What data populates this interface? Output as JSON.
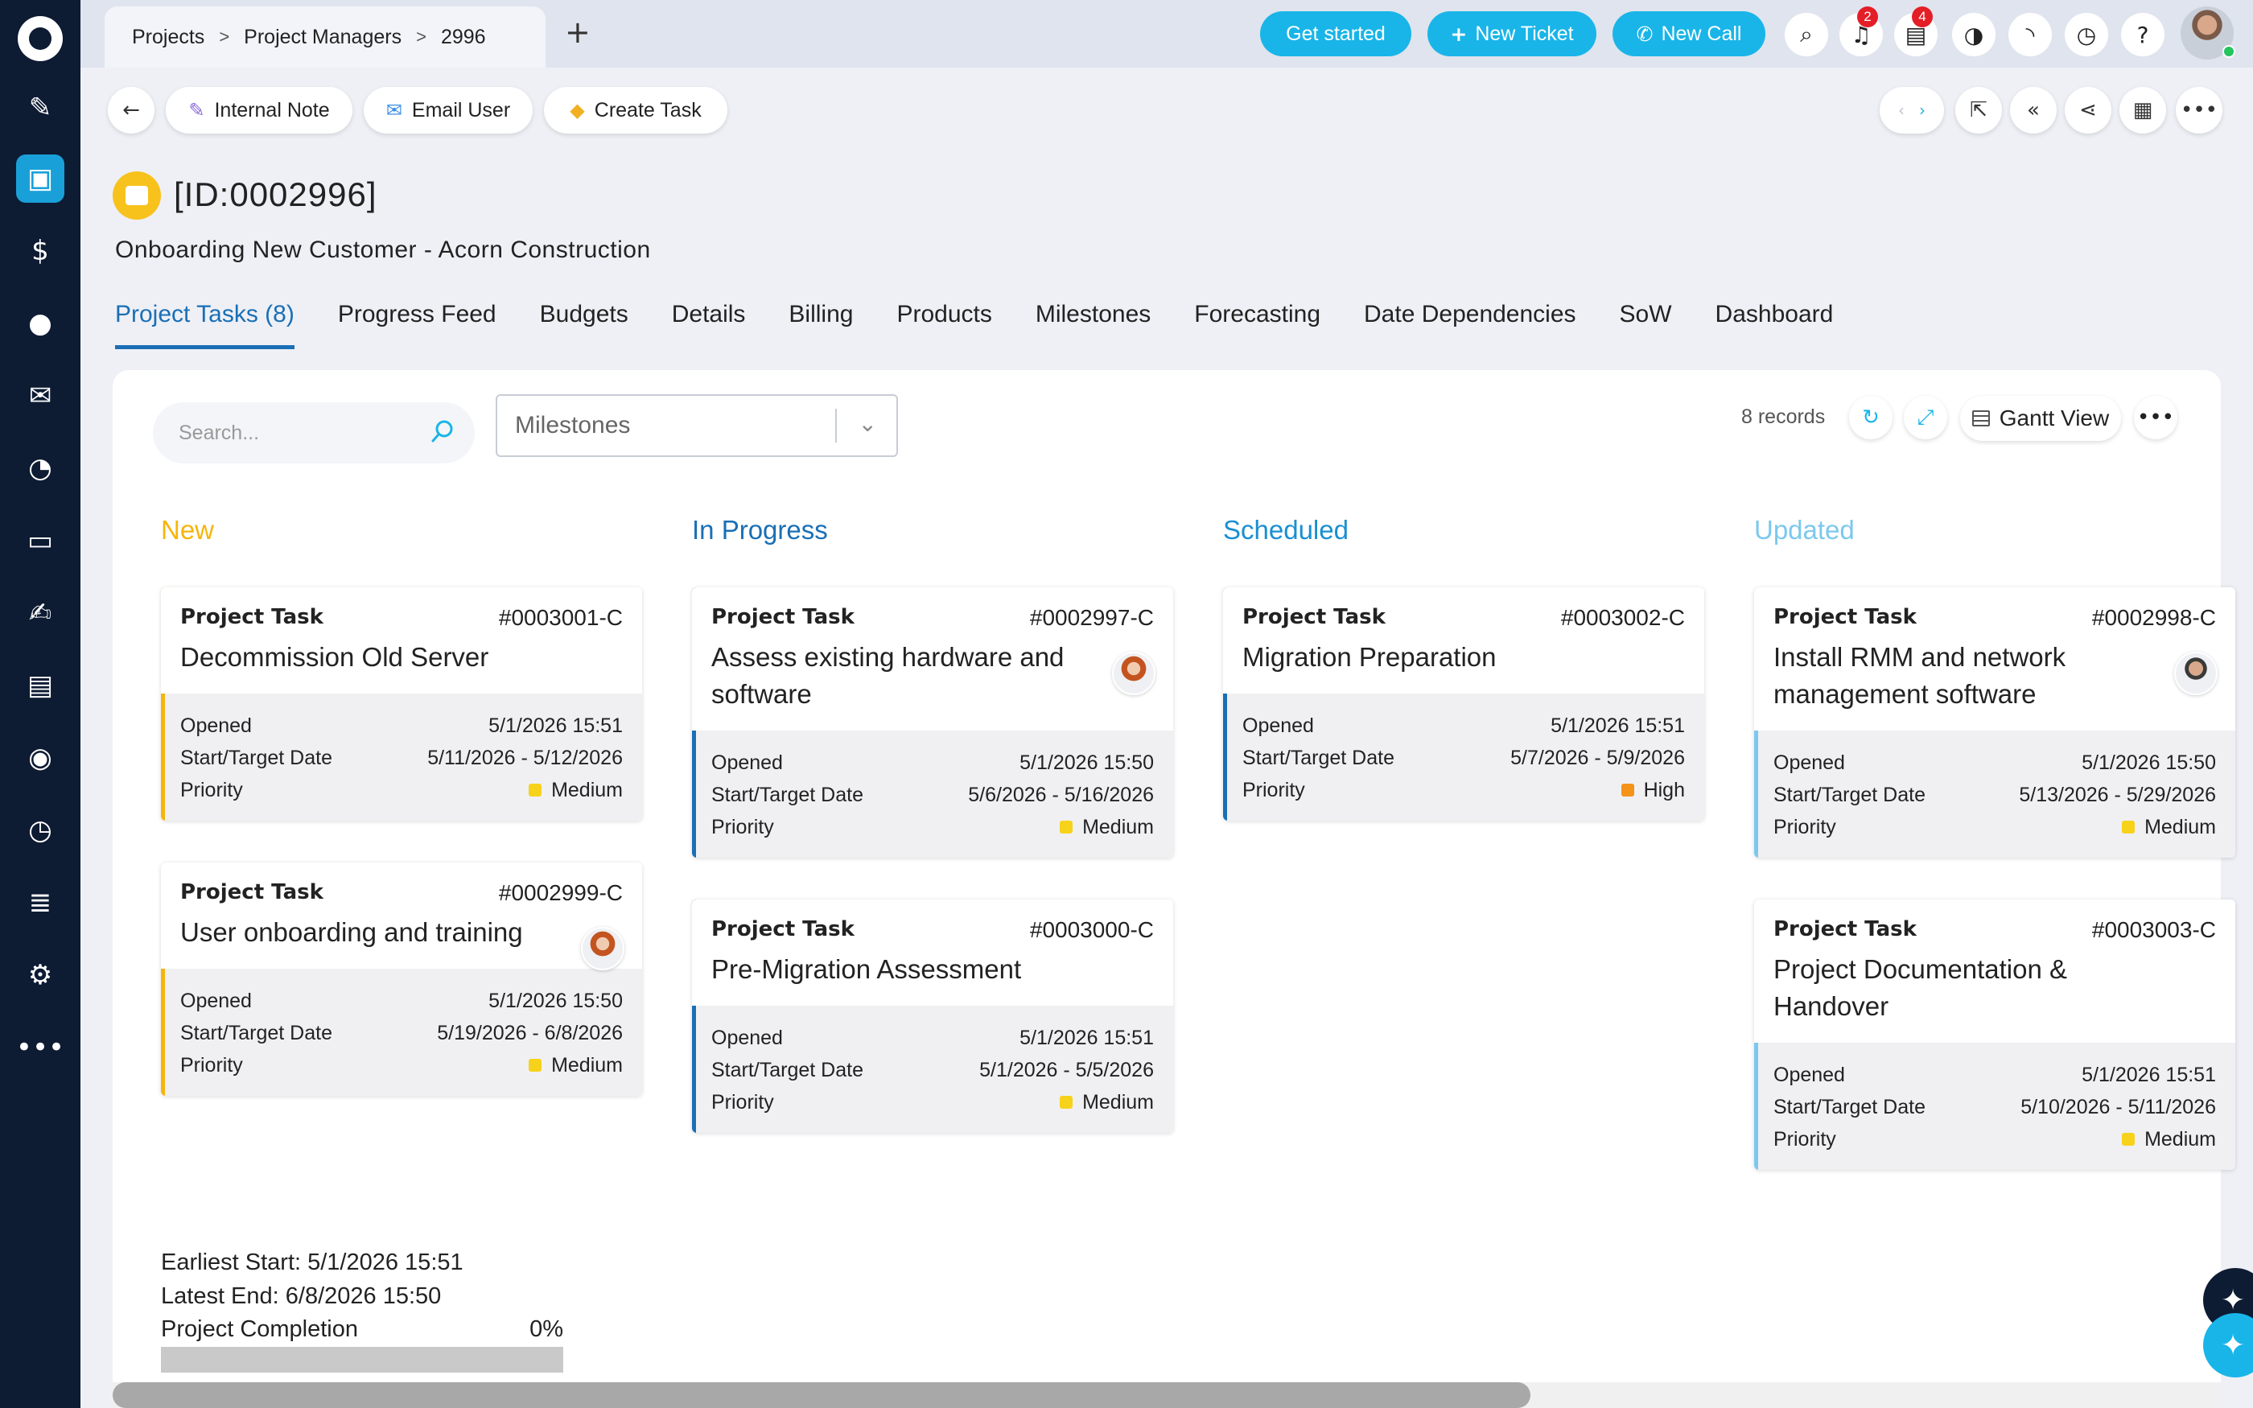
{
  "topbar": {
    "breadcrumb": [
      "Projects",
      "Project Managers",
      "2996"
    ],
    "sep": ">",
    "add_tab": "+",
    "get_started": "Get started",
    "new_ticket": "New Ticket",
    "new_call": "New Call",
    "notif_count": "2",
    "task_count": "4"
  },
  "toolbar": {
    "internal_note": "Internal Note",
    "email_user": "Email User",
    "create_task": "Create Task"
  },
  "header": {
    "id": "[ID:0002996]",
    "title": "Onboarding New Customer - Acorn Construction"
  },
  "tabs": [
    "Project Tasks (8)",
    "Progress Feed",
    "Budgets",
    "Details",
    "Billing",
    "Products",
    "Milestones",
    "Forecasting",
    "Date Dependencies",
    "SoW",
    "Dashboard"
  ],
  "filters": {
    "search_placeholder": "Search...",
    "milestones": "Milestones",
    "records": "8 records",
    "gantt": "Gantt View"
  },
  "columns": [
    {
      "title": "New",
      "color": "#f5b50a"
    },
    {
      "title": "In Progress",
      "color": "#1a6fb5"
    },
    {
      "title": "Scheduled",
      "color": "#1a8fd0"
    },
    {
      "title": "Updated",
      "color": "#7cc8ee"
    }
  ],
  "labels": {
    "kind": "Project Task",
    "opened": "Opened",
    "start_target": "Start/Target Date",
    "priority": "Priority"
  },
  "cards": [
    {
      "num": "#0003001-C",
      "title": "Decommission Old Server",
      "opened": "5/1/2026 15:51",
      "dates": "5/11/2026 - 5/12/2026",
      "priority": "Medium",
      "prio_color": "#f7d21a",
      "bar": "#f5b50a"
    },
    {
      "num": "#0002999-C",
      "title": "User onboarding and training",
      "opened": "5/1/2026 15:50",
      "dates": "5/19/2026 - 6/8/2026",
      "priority": "Medium",
      "prio_color": "#f7d21a",
      "bar": "#f5b50a"
    },
    {
      "num": "#0002997-C",
      "title": "Assess existing hardware and software",
      "opened": "5/1/2026 15:50",
      "dates": "5/6/2026 - 5/16/2026",
      "priority": "Medium",
      "prio_color": "#f7d21a",
      "bar": "#1a6fb5"
    },
    {
      "num": "#0003000-C",
      "title": "Pre-Migration Assessment",
      "opened": "5/1/2026 15:51",
      "dates": "5/1/2026 - 5/5/2026",
      "priority": "Medium",
      "prio_color": "#f7d21a",
      "bar": "#1a6fb5"
    },
    {
      "num": "#0003002-C",
      "title": "Migration Preparation",
      "opened": "5/1/2026 15:51",
      "dates": "5/7/2026 - 5/9/2026",
      "priority": "High",
      "prio_color": "#f5921a",
      "bar": "#1a6fb5"
    },
    {
      "num": "#0002998-C",
      "title": "Install RMM and network management software",
      "opened": "5/1/2026 15:50",
      "dates": "5/13/2026 - 5/29/2026",
      "priority": "Medium",
      "prio_color": "#f7d21a",
      "bar": "#7cc8ee"
    },
    {
      "num": "#0003003-C",
      "title": "Project Documentation & Handover",
      "opened": "5/1/2026 15:51",
      "dates": "5/10/2026 - 5/11/2026",
      "priority": "Medium",
      "prio_color": "#f7d21a",
      "bar": "#7cc8ee"
    }
  ],
  "stats": {
    "earliest": "Earliest Start: 5/1/2026 15:51",
    "latest": "Latest End: 6/8/2026 15:50",
    "completion_label": "Project Completion",
    "completion_value": "0%",
    "completion_fraction": 0
  }
}
